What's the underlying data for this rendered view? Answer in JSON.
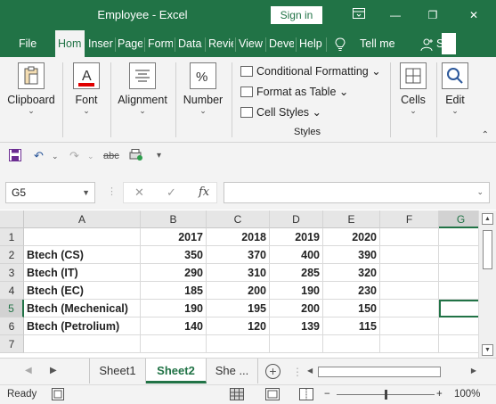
{
  "window": {
    "title": "Employee  -  Excel",
    "signin_label": "Sign in",
    "minimize_glyph": "—",
    "restore_glyph": "❐",
    "close_glyph": "✕"
  },
  "tabs": {
    "file": "File",
    "home": "Hom",
    "insert": "Inser",
    "page": "Page",
    "formulas": "Form",
    "data": "Data",
    "review": "Revie",
    "view": "View",
    "developer": "Deve",
    "help": "Help",
    "tellme": "Tell me",
    "share_partial": "S"
  },
  "ribbon": {
    "clipboard": "Clipboard",
    "font": "Font",
    "alignment": "Alignment",
    "number": "Number",
    "conditional_formatting": "Conditional Formatting",
    "format_as_table": "Format as Table",
    "cell_styles": "Cell Styles",
    "styles": "Styles",
    "cells": "Cells",
    "editing_partial": "Edit"
  },
  "formula_bar": {
    "name_box": "G5",
    "cancel_glyph": "✕",
    "enter_glyph": "✓",
    "fx_glyph": "fx",
    "formula": ""
  },
  "sheet": {
    "columns": [
      "A",
      "B",
      "C",
      "D",
      "E",
      "F",
      "G"
    ],
    "selected_cell": "G5",
    "rows": [
      {
        "num": "1",
        "cells": [
          "",
          "2017",
          "2018",
          "2019",
          "2020",
          "",
          ""
        ]
      },
      {
        "num": "2",
        "cells": [
          "Btech (CS)",
          "350",
          "370",
          "400",
          "390",
          "",
          ""
        ]
      },
      {
        "num": "3",
        "cells": [
          "Btech (IT)",
          "290",
          "310",
          "285",
          "320",
          "",
          ""
        ]
      },
      {
        "num": "4",
        "cells": [
          "Btech (EC)",
          "185",
          "200",
          "190",
          "230",
          "",
          ""
        ]
      },
      {
        "num": "5",
        "cells": [
          "Btech (Mechenical)",
          "190",
          "195",
          "200",
          "150",
          "",
          ""
        ]
      },
      {
        "num": "6",
        "cells": [
          "Btech (Petrolium)",
          "140",
          "120",
          "139",
          "115",
          "",
          ""
        ]
      },
      {
        "num": "7",
        "cells": [
          "",
          "",
          "",
          "",
          "",
          "",
          ""
        ]
      }
    ]
  },
  "sheet_tabs": {
    "tabs": [
      "Sheet1",
      "Sheet2",
      "She ..."
    ],
    "active": "Sheet2",
    "add_glyph": "+"
  },
  "status": {
    "ready": "Ready",
    "zoom_minus": "−",
    "zoom_plus": "+",
    "zoom": "100%",
    "zoom_fraction": 0.5
  },
  "theme": {
    "accent": "#217346",
    "ribbon_bg": "#f3f3f3",
    "header_bg": "#e6e6e6"
  }
}
